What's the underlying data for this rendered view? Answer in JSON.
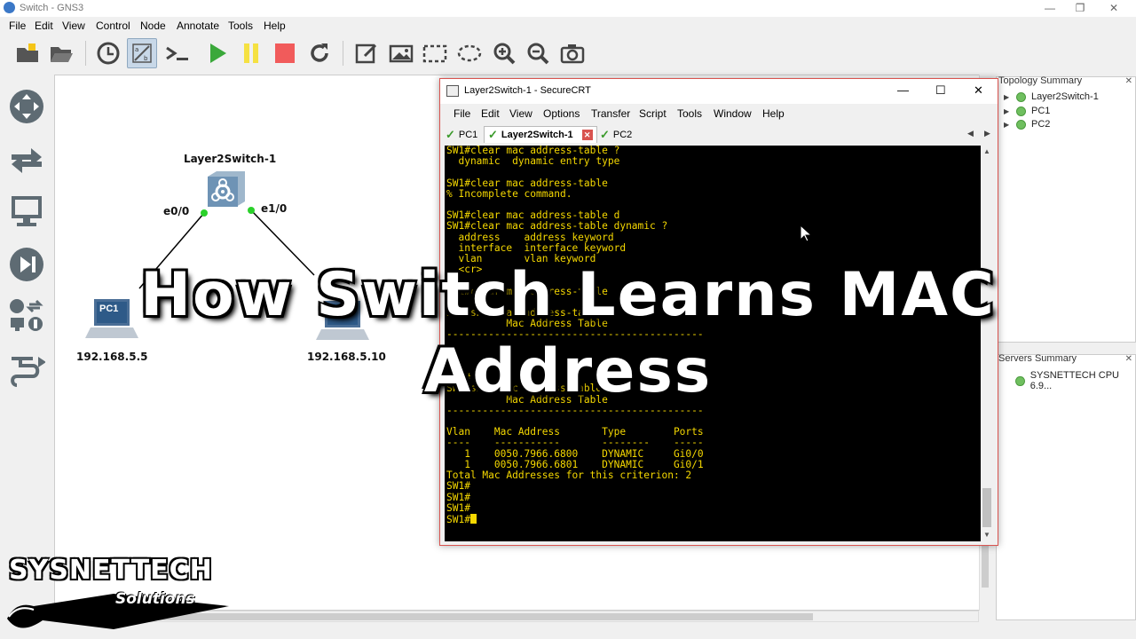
{
  "window": {
    "title": "Switch - GNS3",
    "controls": {
      "minimize": "—",
      "restore": "❐",
      "close": "✕"
    }
  },
  "menu": [
    "File",
    "Edit",
    "View",
    "Control",
    "Node",
    "Annotate",
    "Tools",
    "Help"
  ],
  "toolbar": [
    "open-project-icon",
    "open-folder-icon",
    "snapshot-clock-icon",
    "show-interface-labels-icon",
    "console-all-icon",
    "start-all-icon",
    "suspend-all-icon",
    "stop-all-icon",
    "reload-all-icon",
    "add-note-icon",
    "insert-image-icon",
    "draw-rectangle-icon",
    "draw-ellipse-icon",
    "zoom-in-icon",
    "zoom-out-icon",
    "screenshot-icon"
  ],
  "device_panel": [
    "routers-icon",
    "switches-icon",
    "end-devices-icon",
    "security-devices-icon",
    "all-devices-icon",
    "add-link-icon"
  ],
  "topology": {
    "switch_label": "Layer2Switch-1",
    "port_left": "e0/0",
    "port_right": "e1/0",
    "pc1_label": "PC1",
    "pc1_ip": "192.168.5.5",
    "pc2_ip": "192.168.5.10"
  },
  "topology_summary": {
    "title": "Topology Summary",
    "items": [
      "Layer2Switch-1",
      "PC1",
      "PC2"
    ],
    "status_color": "#6fbf5f"
  },
  "servers_summary": {
    "title": "Servers Summary",
    "items": [
      "SYSNETTECH CPU 6.9..."
    ]
  },
  "securecrt": {
    "title": "Layer2Switch-1 - SecureCRT",
    "menu": [
      "File",
      "Edit",
      "View",
      "Options",
      "Transfer",
      "Script",
      "Tools",
      "Window",
      "Help"
    ],
    "tabs": [
      "PC1",
      "Layer2Switch-1",
      "PC2"
    ],
    "active_tab": "Layer2Switch-1",
    "terminal_lines": [
      "SW1#clear mac address-table ?",
      "  dynamic  dynamic entry type",
      "",
      "SW1#clear mac address-table",
      "% Incomplete command.",
      "",
      "SW1#clear mac address-table d",
      "SW1#clear mac address-table dynamic ?",
      "  address    address keyword",
      "  interface  interface keyword",
      "  vlan       vlan keyword",
      "  <cr>",
      "",
      "SW1#clear mac address-table",
      "",
      "SW1#show mac address-table",
      "          Mac Address Table",
      "-------------------------------------------",
      "",
      "",
      "",
      "SW1#",
      "SW1#show mac address-table",
      "          Mac Address Table",
      "-------------------------------------------",
      "",
      "Vlan    Mac Address       Type        Ports",
      "----    -----------       --------    -----",
      "   1    0050.7966.6800    DYNAMIC     Gi0/0",
      "   1    0050.7966.6801    DYNAMIC     Gi0/1",
      "Total Mac Addresses for this criterion: 2",
      "SW1#",
      "SW1#",
      "SW1#"
    ],
    "prompt": "SW1#",
    "terminal_color": "#f5d800"
  },
  "overlay_title": [
    "How Switch Learns MAC",
    "Address"
  ],
  "logo": {
    "brand": "SYSNETTECH",
    "tagline": "Solutions"
  }
}
